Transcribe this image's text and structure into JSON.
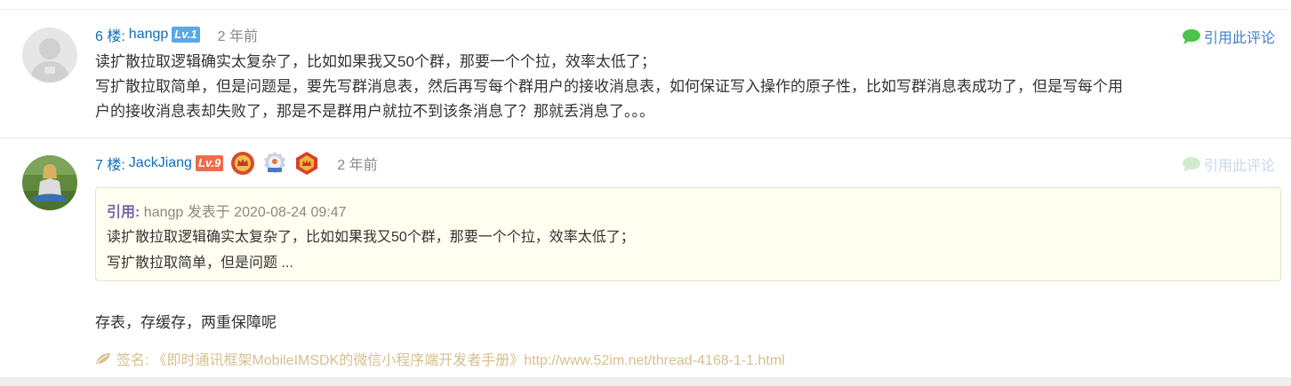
{
  "post6": {
    "floor": "6 楼:",
    "username": "hangp",
    "level": "Lv.1",
    "time": "2 年前",
    "quote_action": "引用此评论",
    "lines": [
      "读扩散拉取逻辑确实太复杂了，比如如果我又50个群，那要一个个拉，效率太低了；",
      "写扩散拉取简单，但是问题是，要先写群消息表，然后再写每个群用户的接收消息表，如何保证写入操作的原子性，比如写群消息表成功了，但是写每个用",
      "户的接收消息表却失败了，那是不是群用户就拉不到该条消息了？那就丢消息了。。。"
    ]
  },
  "post7": {
    "floor": "7 楼:",
    "username": "JackJiang",
    "level": "Lv.9",
    "medals": [
      "crown-medal-icon",
      "silver-medal-icon",
      "king-medal-icon"
    ],
    "time": "2 年前",
    "quote_action": "引用此评论",
    "quote": {
      "label": "引用:",
      "author_line": "hangp 发表于 2020-08-24 09:47",
      "line1": "读扩散拉取逻辑确实太复杂了，比如如果我又50个群，那要一个个拉，效率太低了；",
      "line2": "写扩散拉取简单，但是问题 ..."
    },
    "reply": "存表，存缓存，两重保障呢",
    "signature": {
      "label": "签名:",
      "text": "《即时通讯框架MobileIMSDK的微信小程序端开发者手册》http://www.52im.net/thread-4168-1-1.html"
    }
  },
  "colors": {
    "link_blue": "#0e6eb8",
    "lv1_badge": "#59a8e8",
    "lv9_badge": "#ef6b4a",
    "quote_bubble_green": "#4cc34a",
    "signature_tan": "#d6c08d"
  }
}
